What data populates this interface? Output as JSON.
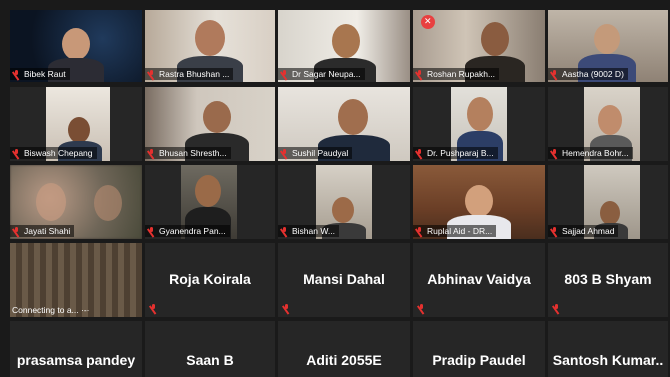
{
  "participants": {
    "row1": [
      "Bibek Raut",
      "Rastra Bhushan ...",
      "Dr Sagar Neupa...",
      "Roshan Rupakh...",
      "Aastha (9002 D)"
    ],
    "row2": [
      "Biswash Chepang",
      "Bhusan Shresth...",
      "Sushil Paudyal",
      "Dr. Pushparaj B...",
      "Hemendra Bohr..."
    ],
    "row3": [
      "Jayati Shahi",
      "Gyanendra Pan...",
      "Bishan W...",
      "Ruplal Aid - DR...",
      "Sajjad Ahmad"
    ],
    "row4": {
      "connecting": "Connecting to a... ·-·",
      "names": [
        "Roja Koirala",
        "Mansi Dahal",
        "Abhinav Vaidya",
        "803 B Shyam"
      ]
    },
    "row5": [
      "prasamsa pandey",
      "Saan B",
      "Aditi 2055E",
      "Pradip Paudel",
      "Santosh  Kumar.."
    ]
  },
  "colors": {
    "muted": "#e5312f",
    "tile": "#262626",
    "background": "#1a1a1a"
  },
  "icons": {
    "muted": "muted-mic-icon",
    "unmute-request": "close-icon"
  }
}
